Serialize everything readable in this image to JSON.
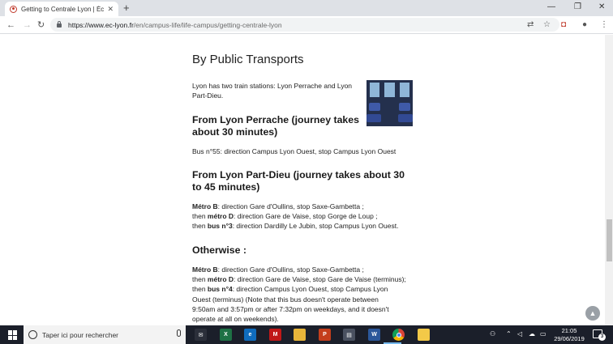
{
  "browser": {
    "tab_title": "Getting to Centrale Lyon | École",
    "url_domain": "https://www.ec-lyon.fr",
    "url_path": "/en/campus-life/life-campus/getting-centrale-lyon"
  },
  "article": {
    "heading": "By Public Transports",
    "intro": "Lyon has two train stations: Lyon Perrache and Lyon Part-Dieu.",
    "sections": [
      {
        "title": "From Lyon Perrache (journey takes about 30 minutes)",
        "lines": [
          {
            "prefix": "",
            "bold": "",
            "text": "Bus n°55: direction Campus Lyon Ouest, stop Campus Lyon Ouest"
          }
        ]
      },
      {
        "title": "From Lyon Part-Dieu (journey takes about 30 to 45 minutes)",
        "lines": [
          {
            "prefix": "",
            "bold": "Métro B",
            "text": ": direction Gare d'Oullins, stop Saxe-Gambetta ;"
          },
          {
            "prefix": "then ",
            "bold": "métro D",
            "text": ": direction Gare de Vaise, stop Gorge de Loup ;"
          },
          {
            "prefix": "then ",
            "bold": "bus n°3",
            "text": ": direction Dardilly Le Jubin, stop Campus Lyon Ouest."
          }
        ]
      },
      {
        "title": "Otherwise :",
        "lines": [
          {
            "prefix": "",
            "bold": "Métro B",
            "text": ": direction Gare d'Oullins, stop Saxe-Gambetta ;"
          },
          {
            "prefix": "then ",
            "bold": "métro D",
            "text": ": direction Gare de Vaise, stop Gare de Vaise (terminus);"
          },
          {
            "prefix": "then ",
            "bold": "bus n°4",
            "text": ": direction Campus Lyon Ouest, stop Campus Lyon Ouest (terminus) (Note that this bus doesn't operate between 9:50am and 3:57pm or after 7:32pm on weekdays, and it doesn't operate at all on weekends)."
          }
        ]
      }
    ]
  },
  "taskbar": {
    "search_placeholder": "Taper ici pour rechercher",
    "time": "21:05",
    "date": "29/06/2019",
    "notifications": "3",
    "apps": [
      {
        "name": "mail-app-icon",
        "color": "#2b2f3a",
        "glyph": "✉"
      },
      {
        "name": "excel-app-icon",
        "color": "#1e7145",
        "glyph": "X"
      },
      {
        "name": "edge-app-icon",
        "color": "#0f6cbd",
        "glyph": "e"
      },
      {
        "name": "mcafee-app-icon",
        "color": "#c01818",
        "glyph": "M"
      },
      {
        "name": "file-explorer-app-icon",
        "color": "#e8b53a",
        "glyph": ""
      },
      {
        "name": "powerpoint-app-icon",
        "color": "#c43e1c",
        "glyph": "P"
      },
      {
        "name": "store-app-icon",
        "color": "#4a5160",
        "glyph": "▤"
      },
      {
        "name": "word-app-icon",
        "color": "#2b579a",
        "glyph": "W"
      },
      {
        "name": "chrome-app-icon",
        "color": "#db4437",
        "glyph": ""
      },
      {
        "name": "notes-app-icon",
        "color": "#f3c948",
        "glyph": ""
      }
    ]
  },
  "colors": {
    "tab_strip": "#dee1e6",
    "taskbar": "#1b1f2a",
    "active_app_indicator": "#76b9ed"
  }
}
